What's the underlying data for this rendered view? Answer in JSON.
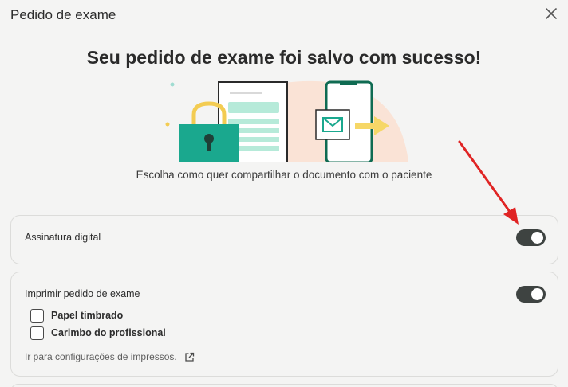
{
  "header": {
    "title": "Pedido de exame"
  },
  "main": {
    "title": "Seu pedido de exame foi salvo com sucesso!",
    "subtitle": "Escolha como quer compartilhar o documento com o paciente"
  },
  "options": {
    "digital_signature": {
      "label": "Assinatura digital",
      "enabled": true
    },
    "print": {
      "label": "Imprimir pedido de exame",
      "enabled": true,
      "checkboxes": [
        {
          "label": "Papel timbrado",
          "checked": false
        },
        {
          "label": "Carimbo do profissional",
          "checked": false
        }
      ],
      "settings_link": "Ir para configurações de impressos."
    }
  },
  "colors": {
    "toggle_on": "#3e4341",
    "lock": "#1aa88e",
    "phone_frame": "#0f6b52",
    "accent_yellow": "#f6d767",
    "annotation_arrow": "#e02424"
  },
  "icons": {
    "close": "close-icon",
    "external_link": "external-link-icon"
  }
}
